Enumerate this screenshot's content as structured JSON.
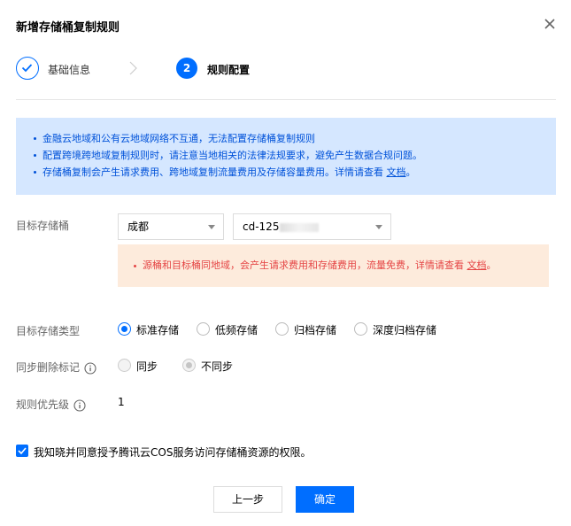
{
  "dialog": {
    "title": "新增存储桶复制规则",
    "close_icon": "close-icon"
  },
  "steps": [
    {
      "number": "1",
      "label": "基础信息",
      "state": "done"
    },
    {
      "number": "2",
      "label": "规则配置",
      "state": "active"
    }
  ],
  "notice": {
    "items": [
      "金融云地域和公有云地域网络不互通，无法配置存储桶复制规则",
      "配置跨境跨地域复制规则时，请注意当地相关的法律法规要求，避免产生数据合规问题。",
      "存储桶复制会产生请求费用、跨地域复制流量费用及存储容量费用。详情请查看"
    ],
    "link_text": "文档",
    "link_suffix": "。"
  },
  "target_bucket": {
    "label": "目标存储桶",
    "region_value": "成都",
    "bucket_value_visible": "cd-125"
  },
  "warning": {
    "text": "源桶和目标桶同地域，会产生请求费用和存储费用，流量免费，详情请查看",
    "link_text": "文档",
    "suffix": "。"
  },
  "storage_class": {
    "label": "目标存储类型",
    "options": [
      "标准存储",
      "低频存储",
      "归档存储",
      "深度归档存储"
    ],
    "selected": "标准存储"
  },
  "sync_delete": {
    "label": "同步删除标记",
    "options": [
      "同步",
      "不同步"
    ],
    "selected": "不同步",
    "disabled": true
  },
  "priority": {
    "label": "规则优先级",
    "value": "1"
  },
  "agreement": {
    "checked": true,
    "text": "我知晓并同意授予腾讯云COS服务访问存储桶资源的权限。"
  },
  "buttons": {
    "prev": "上一步",
    "ok": "确定"
  },
  "colors": {
    "accent": "#006eff",
    "notice_bg": "#d5e7ff",
    "notice_text": "#0052d9",
    "warning_bg": "#fdebdc",
    "warning_text": "#e54545"
  }
}
